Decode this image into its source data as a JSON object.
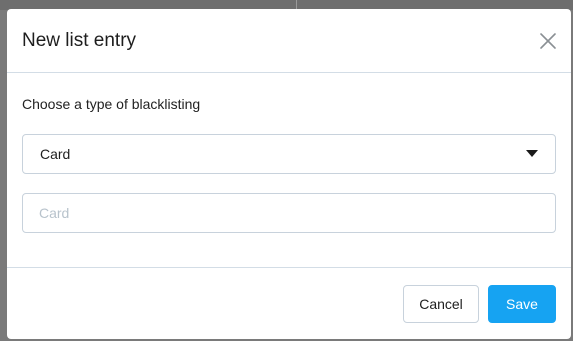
{
  "modal": {
    "title": "New list entry",
    "close_icon": "close-icon"
  },
  "form": {
    "type_label": "Choose a type of blacklisting",
    "type_select": {
      "selected": "Card",
      "caret_icon": "caret-down-icon"
    },
    "value_input": {
      "value": "",
      "placeholder": "Card"
    }
  },
  "footer": {
    "cancel_label": "Cancel",
    "save_label": "Save"
  },
  "colors": {
    "primary": "#16a3f2",
    "border": "#c8d2dc",
    "divider": "#d3dde6",
    "backdrop": "#7a7a7a"
  }
}
